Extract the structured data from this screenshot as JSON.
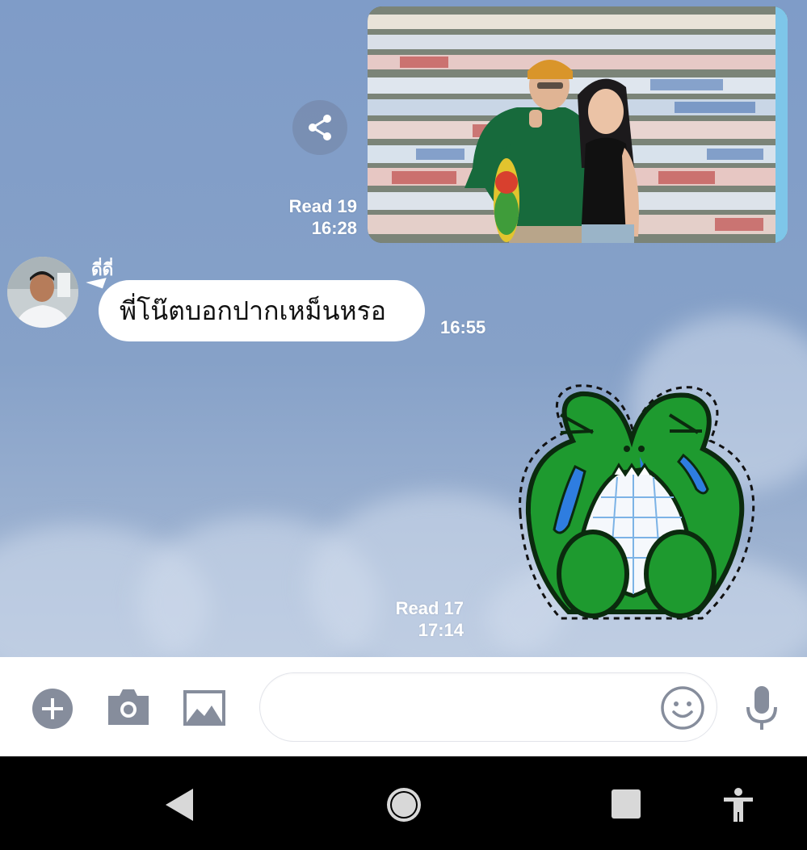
{
  "chat": {
    "sent_photo": {
      "read_label": "Read 19",
      "time": "16:28"
    },
    "incoming": {
      "sender": "ดี่ดี่",
      "text": "พี่โน๊ตบอกปากเหม็นหรอ",
      "time": "16:55"
    },
    "sent_sticker": {
      "read_label": "Read 17",
      "time": "17:14"
    }
  },
  "input_bar": {
    "placeholder": "",
    "icons": [
      "plus-icon",
      "camera-icon",
      "image-icon",
      "emoji-icon",
      "microphone-icon"
    ]
  },
  "nav_bar": {
    "icons": [
      "back-icon",
      "home-icon",
      "recents-icon",
      "accessibility-icon"
    ]
  },
  "colors": {
    "chat_background": "#86a1c8",
    "icon_gray": "#868d9c",
    "sticker_green": "#1e9a2f"
  }
}
